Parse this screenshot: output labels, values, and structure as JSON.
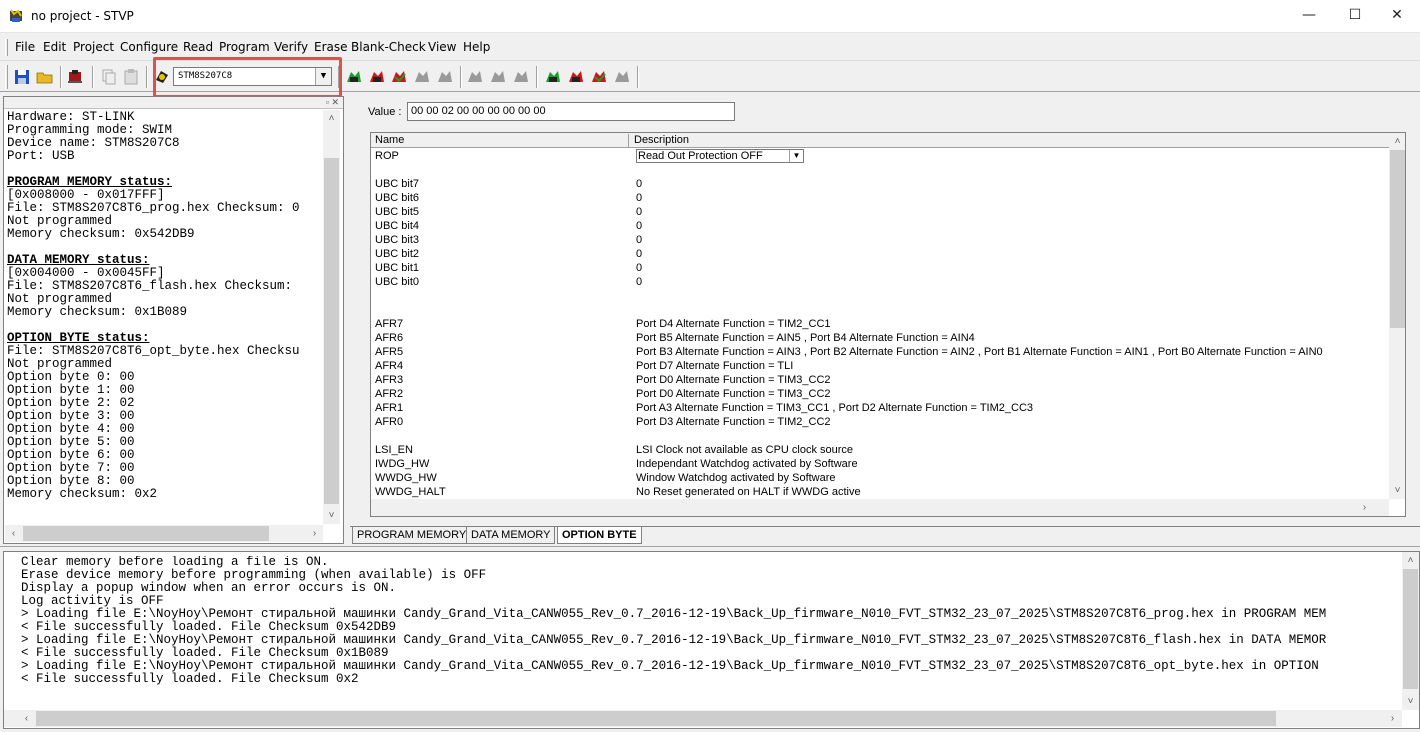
{
  "window": {
    "title": "no project - STVP",
    "minimize": "—",
    "maximize": "☐",
    "close": "✕"
  },
  "menu": {
    "items": [
      "File",
      "Edit",
      "Project",
      "Configure",
      "Read",
      "Program",
      "Verify",
      "Erase",
      "Blank-Check",
      "View",
      "Help"
    ]
  },
  "toolbar": {
    "device": "STM8S207C8",
    "icons": [
      "save-icon",
      "open-folder-icon",
      "device-icon",
      "copy-icon",
      "paste-icon",
      "chip-icon",
      "read-icon",
      "program-icon",
      "verify-icon",
      "erase-icon",
      "blank-check-icon"
    ]
  },
  "info_panel": {
    "lines": [
      {
        "text": "Hardware: ST-LINK",
        "heading": false
      },
      {
        "text": "Programming mode: SWIM",
        "heading": false
      },
      {
        "text": "Device name: STM8S207C8",
        "heading": false
      },
      {
        "text": "Port: USB",
        "heading": false
      },
      {
        "text": "",
        "heading": false
      },
      {
        "text": "PROGRAM MEMORY status:",
        "heading": true
      },
      {
        "text": "[0x008000 - 0x017FFF]",
        "heading": false
      },
      {
        "text": "File: STM8S207C8T6_prog.hex Checksum: 0",
        "heading": false
      },
      {
        "text": "Not programmed",
        "heading": false
      },
      {
        "text": "Memory checksum: 0x542DB9",
        "heading": false
      },
      {
        "text": "",
        "heading": false
      },
      {
        "text": "DATA MEMORY status:",
        "heading": true
      },
      {
        "text": "[0x004000 - 0x0045FF]",
        "heading": false
      },
      {
        "text": "File: STM8S207C8T6_flash.hex Checksum:",
        "heading": false
      },
      {
        "text": "Not programmed",
        "heading": false
      },
      {
        "text": "Memory checksum: 0x1B089",
        "heading": false
      },
      {
        "text": "",
        "heading": false
      },
      {
        "text": "OPTION BYTE status:",
        "heading": true
      },
      {
        "text": "File: STM8S207C8T6_opt_byte.hex Checksu",
        "heading": false
      },
      {
        "text": "Not programmed",
        "heading": false
      },
      {
        "text": "Option byte 0: 00",
        "heading": false
      },
      {
        "text": "Option byte 1: 00",
        "heading": false
      },
      {
        "text": "Option byte 2: 02",
        "heading": false
      },
      {
        "text": "Option byte 3: 00",
        "heading": false
      },
      {
        "text": "Option byte 4: 00",
        "heading": false
      },
      {
        "text": "Option byte 5: 00",
        "heading": false
      },
      {
        "text": "Option byte 6: 00",
        "heading": false
      },
      {
        "text": "Option byte 7: 00",
        "heading": false
      },
      {
        "text": "Option byte 8: 00",
        "heading": false
      },
      {
        "text": "Memory checksum: 0x2",
        "heading": false
      }
    ]
  },
  "value_field": {
    "label": "Value :",
    "value": "00 00 02 00 00 00 00 00 00"
  },
  "option_table": {
    "headers": [
      "Name",
      "Description"
    ],
    "rop": {
      "name": "ROP",
      "value": "Read Out Protection OFF"
    },
    "rows": [
      {
        "name": "",
        "desc": ""
      },
      {
        "name": "UBC bit7",
        "desc": "0"
      },
      {
        "name": "UBC bit6",
        "desc": "0"
      },
      {
        "name": "UBC bit5",
        "desc": "0"
      },
      {
        "name": "UBC bit4",
        "desc": "0"
      },
      {
        "name": "UBC bit3",
        "desc": "0"
      },
      {
        "name": "UBC bit2",
        "desc": "0"
      },
      {
        "name": "UBC bit1",
        "desc": "0"
      },
      {
        "name": "UBC bit0",
        "desc": "0"
      },
      {
        "name": "",
        "desc": ""
      },
      {
        "name": "",
        "desc": ""
      },
      {
        "name": "AFR7",
        "desc": "Port D4 Alternate Function = TIM2_CC1"
      },
      {
        "name": "AFR6",
        "desc": "Port B5 Alternate Function = AIN5 , Port B4 Alternate Function = AIN4"
      },
      {
        "name": "AFR5",
        "desc": "Port B3 Alternate Function = AIN3 , Port B2 Alternate Function = AIN2 , Port B1 Alternate Function = AIN1 , Port B0 Alternate Function = AIN0"
      },
      {
        "name": "AFR4",
        "desc": "Port D7 Alternate Function = TLI"
      },
      {
        "name": "AFR3",
        "desc": "Port D0 Alternate Function = TIM3_CC2"
      },
      {
        "name": "AFR2",
        "desc": "Port D0 Alternate Function = TIM3_CC2"
      },
      {
        "name": "AFR1",
        "desc": "Port A3 Alternate Function = TIM3_CC1 , Port D2 Alternate Function = TIM2_CC3"
      },
      {
        "name": "AFR0",
        "desc": "Port D3 Alternate Function = TIM2_CC2"
      },
      {
        "name": "",
        "desc": ""
      },
      {
        "name": "LSI_EN",
        "desc": "LSI Clock not available as CPU clock source"
      },
      {
        "name": "IWDG_HW",
        "desc": "Independant Watchdog activated by Software"
      },
      {
        "name": "WWDG_HW",
        "desc": "Window Watchdog activated by Software"
      },
      {
        "name": "WWDG_HALT",
        "desc": "No Reset generated on HALT if WWDG active"
      }
    ]
  },
  "tabs": [
    {
      "label": "PROGRAM MEMORY",
      "active": false
    },
    {
      "label": "DATA MEMORY",
      "active": false
    },
    {
      "label": "OPTION BYTE",
      "active": true
    }
  ],
  "log": {
    "lines": [
      "Clear memory before loading a file is ON.",
      "Erase device memory before programming (when available) is OFF",
      "Display a popup window when an error occurs is ON.",
      "Log activity is OFF",
      "> Loading file E:\\NoyHoy\\Ремонт стиральной машинки Candy_Grand_Vita_CANW055_Rev_0.7_2016-12-19\\Back_Up_firmware_N010_FVT_STM32_23_07_2025\\STM8S207C8T6_prog.hex in PROGRAM MEM",
      "< File successfully loaded. File Checksum 0x542DB9",
      "> Loading file E:\\NoyHoy\\Ремонт стиральной машинки Candy_Grand_Vita_CANW055_Rev_0.7_2016-12-19\\Back_Up_firmware_N010_FVT_STM32_23_07_2025\\STM8S207C8T6_flash.hex in DATA MEMOR",
      "< File successfully loaded. File Checksum 0x1B089",
      "> Loading file E:\\NoyHoy\\Ремонт стиральной машинки Candy_Grand_Vita_CANW055_Rev_0.7_2016-12-19\\Back_Up_firmware_N010_FVT_STM32_23_07_2025\\STM8S207C8T6_opt_byte.hex in OPTION",
      "< File successfully loaded. File Checksum 0x2"
    ]
  },
  "colors": {
    "highlight": "#d9534f",
    "chip_green": "#1a9e2c",
    "chip_red": "#d0141c",
    "chip_gray": "#9a9a9a"
  }
}
